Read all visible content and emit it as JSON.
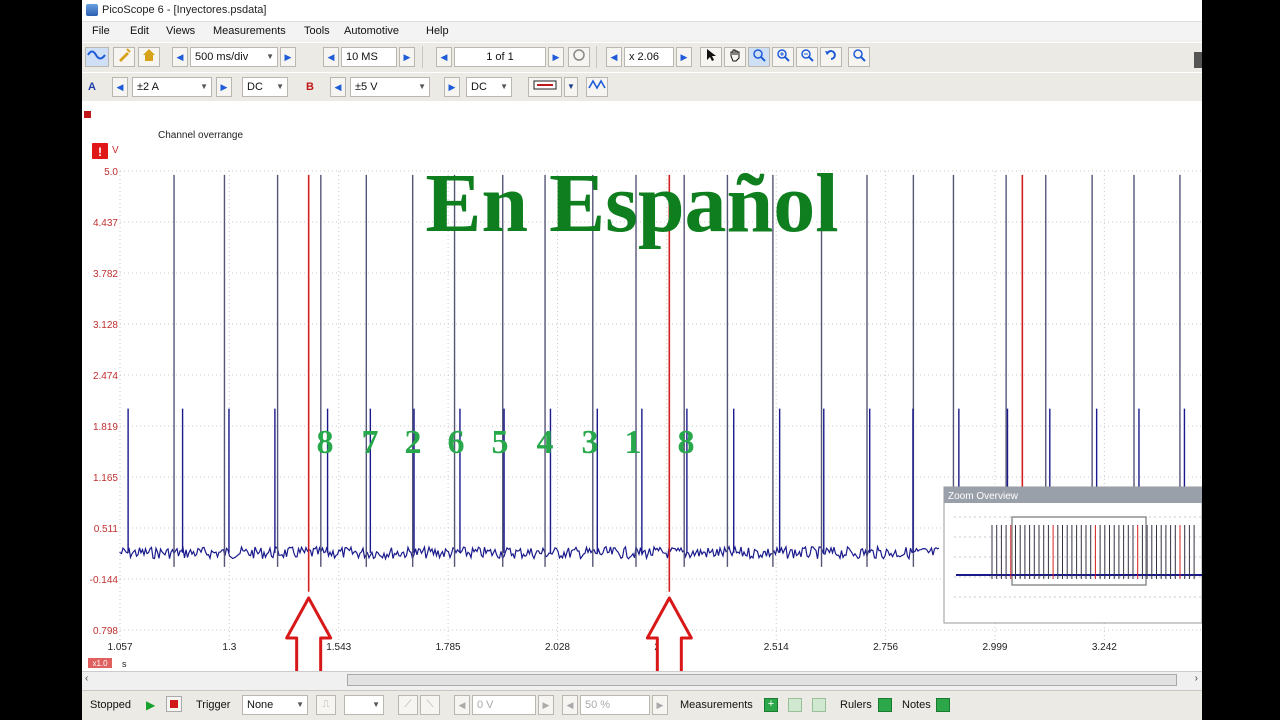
{
  "window": {
    "title": "PicoScope 6 - [Inyectores.psdata]"
  },
  "menu": [
    "File",
    "Edit",
    "Views",
    "Measurements",
    "Tools",
    "Automotive",
    "Help"
  ],
  "toolbar1": {
    "timebase": "500 ms/div",
    "samples": "10 MS",
    "buffer": "1 of 1",
    "zoom": "x 2.06"
  },
  "toolbar2": {
    "channel_a_label": "A",
    "channel_a_range": "±2 A",
    "channel_a_coupling": "DC",
    "channel_b_label": "B",
    "channel_b_range": "±5 V",
    "channel_b_coupling": "DC"
  },
  "plot": {
    "warning": "Channel overrange",
    "unit_v": "V",
    "y_ticks": [
      "5.0",
      "4.437",
      "3.782",
      "3.128",
      "2.474",
      "1.819",
      "1.165",
      "0.511",
      "-0.144",
      "0.798"
    ],
    "x_ticks": [
      "1.057",
      "1.3",
      "1.543",
      "1.785",
      "2.028",
      "2.271",
      "2.514",
      "2.756",
      "2.999",
      "3.242"
    ],
    "x_unit": "s",
    "x_zoom_badge": "x1.0",
    "overlay_title": "En Español",
    "cylinder_order": [
      "8",
      "7",
      "2",
      "6",
      "5",
      "4",
      "3",
      "1",
      "8"
    ],
    "zoom_overview_title": "Zoom Overview"
  },
  "status": {
    "state": "Stopped",
    "trigger_label": "Trigger",
    "trigger_mode": "None",
    "trigger_level": "0 V",
    "pretrigger": "50 %",
    "measurements_label": "Measurements",
    "rulers_label": "Rulers",
    "notes_label": "Notes"
  },
  "colors": {
    "trace_a": "#1a1a8c",
    "trace_b": "#d42020",
    "overlay_text": "#0e7e1e",
    "cylinder_numbers": "#27a84a",
    "arrow": "#d81818"
  },
  "chart_data": {
    "type": "line",
    "x_unit": "s",
    "xlim": [
      1.057,
      3.46
    ],
    "ylim": [
      -0.798,
      5.0
    ],
    "series": [
      {
        "name": "A",
        "baseline": 0.1,
        "tall_spikes_x": [
          1.177,
          1.289,
          1.407,
          1.503,
          1.604,
          1.707,
          1.8,
          1.907,
          2.001,
          2.107,
          2.203,
          2.31,
          2.406,
          2.507,
          2.615,
          2.716,
          2.819,
          2.908,
          3.025,
          3.113,
          3.216,
          3.309,
          3.411
        ],
        "small_spikes_x": [
          1.075,
          1.196,
          1.299,
          1.401,
          1.518,
          1.613,
          1.71,
          1.812,
          1.91,
          2.013,
          2.117,
          2.216,
          2.316,
          2.42,
          2.522,
          2.62,
          2.722,
          2.818,
          2.92,
          3.028,
          3.122,
          3.226,
          3.32,
          3.421
        ]
      },
      {
        "name": "B",
        "spikes_x": [
          1.476,
          2.277,
          3.061
        ]
      }
    ]
  }
}
